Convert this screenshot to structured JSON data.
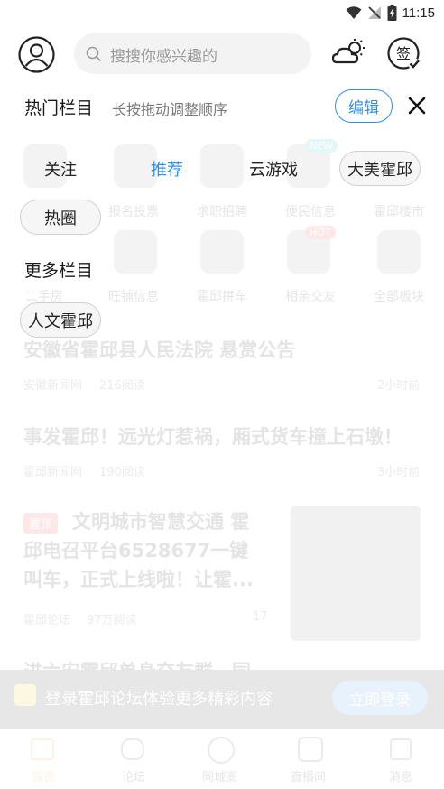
{
  "status_bar": {
    "time": "11:15",
    "icons": [
      "wifi-icon",
      "no-signal-icon",
      "battery-charging-icon"
    ]
  },
  "header": {
    "avatar_icon": "user-avatar-icon",
    "search_placeholder": "搜搜你感兴趣的",
    "search_icon": "search-icon",
    "weather_icon": "cloud-sun-icon",
    "checkin_icon": "sign-in-icon",
    "checkin_label": "签"
  },
  "channels": {
    "hot_title": "热门栏目",
    "hint": "长按拖动调整顺序",
    "edit_label": "编辑",
    "close_icon": "close-icon",
    "hot_items": [
      {
        "label": "关注",
        "selected": false
      },
      {
        "label": "推荐",
        "selected": true
      },
      {
        "label": "云游戏",
        "selected": false
      },
      {
        "label": "大美霍邱",
        "selected": false
      },
      {
        "label": "热圈",
        "selected": false
      }
    ],
    "more_title": "更多栏目",
    "more_items": [
      {
        "label": "人文霍邱"
      }
    ]
  },
  "background_feed": {
    "grid_row1": [
      "报名投票",
      "求职招聘",
      "便民信息",
      "霍邱楼市"
    ],
    "grid_row2": [
      "二手房",
      "旺铺信息",
      "霍邱拼车",
      "相亲交友",
      "全部板块"
    ],
    "grid_badge_new": "NEW",
    "grid_badge_hot": "HOT",
    "article1_title": "安徽省霍邱县人民法院 悬赏公告",
    "article1_source": "安徽新闻网",
    "article1_views": "216阅读",
    "article1_time": "2小时前",
    "article2_title": "事发霍邱！远光灯惹祸，厢式货车撞上石墩！",
    "article2_source": "霍邱新闻网",
    "article2_views": "190阅读",
    "article2_time": "3小时前",
    "article3_tag": "置顶",
    "article3_title_line1": "文明城市智慧交通 霍",
    "article3_title_line2": "邱电召平台6528677一键",
    "article3_title_line3": "叫车，正式上线啦！让霍...",
    "article3_source": "霍邱论坛",
    "article3_views": "97万阅读",
    "article3_comments": "17",
    "article4_title": "进六安霍邱单身交友群，同",
    "login_banner_text": "登录霍邱论坛体验更多精彩内容",
    "login_banner_button": "立即登录",
    "tabs": [
      "首页",
      "论坛",
      "同城圈",
      "直播间",
      "消息"
    ]
  }
}
